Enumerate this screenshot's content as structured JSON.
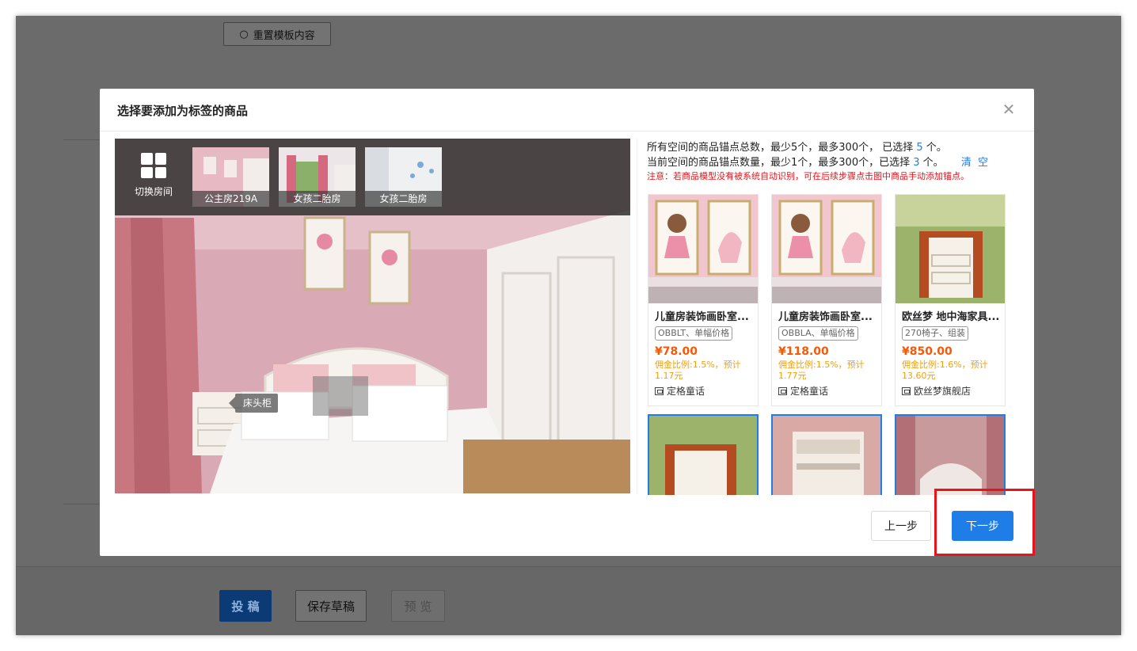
{
  "background": {
    "reset_button_label": "重置模板内容",
    "submit_label": "投 稿",
    "draft_label": "保存草稿",
    "preview_label": "预 览"
  },
  "modal": {
    "title": "选择要添加为标签的商品",
    "switch_room_label": "切换房间",
    "rooms": [
      {
        "label": "公主房219A"
      },
      {
        "label": "女孩二胎房"
      },
      {
        "label": "女孩二胎房"
      }
    ],
    "anchor_tag": "床头柜",
    "info": {
      "line1_prefix": "所有空间的商品锚点总数，最少5个，最多300个， 已选择",
      "line1_count": "5",
      "line1_suffix": "个。",
      "line2_prefix": "当前空间的商品锚点数量，最少1个，最多300个，已选择",
      "line2_count": "3",
      "line2_suffix": "个。",
      "clear_label": "清 空",
      "warning": "注意：若商品模型没有被系统自动识别，可在后续步骤点击图中商品手动添加锚点。"
    },
    "products": [
      {
        "title": "儿童房装饰画卧室...",
        "spec": "OBBLT、单幅价格",
        "price": "¥78.00",
        "commission": "佣金比例:1.5%，预计1.17元",
        "shop": "定格童话"
      },
      {
        "title": "儿童房装饰画卧室...",
        "spec": "OBBLA、单幅价格",
        "price": "¥118.00",
        "commission": "佣金比例:1.5%，预计1.77元",
        "shop": "定格童话"
      },
      {
        "title": "欧丝梦 地中海家具...",
        "spec": "270椅子、组装",
        "price": "¥850.00",
        "commission": "佣金比例:1.6%，预计13.60元",
        "shop": "欧丝梦旗舰店"
      }
    ],
    "prev_label": "上一步",
    "next_label": "下一步"
  },
  "colors": {
    "accent": "#1e7de6",
    "price": "#f25a0a",
    "commission": "#f5a000",
    "warning": "#e8141b"
  }
}
